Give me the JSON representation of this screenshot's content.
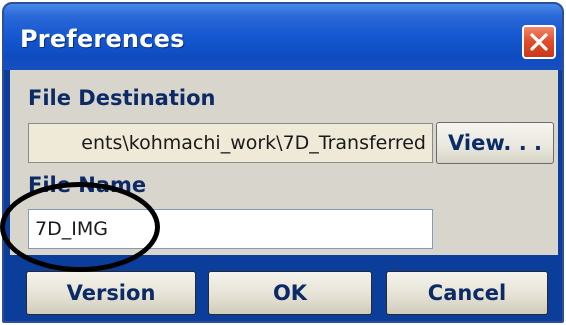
{
  "window": {
    "title": "Preferences",
    "close_icon": "close-x-icon"
  },
  "file_destination": {
    "label": "File Destination",
    "value": "ents\\kohmachi_work\\7D_Transferred",
    "browse_label": "View. . ."
  },
  "file_name": {
    "label": "File Name",
    "value": "7D_IMG"
  },
  "buttons": {
    "version": "Version",
    "ok": "OK",
    "cancel": "Cancel"
  },
  "colors": {
    "title_bar": "#1457d0",
    "dialog_body": "#d8d5cc",
    "close_button": "#e0502f",
    "label_text": "#0b2a66",
    "annotation_ring": "#000000"
  }
}
